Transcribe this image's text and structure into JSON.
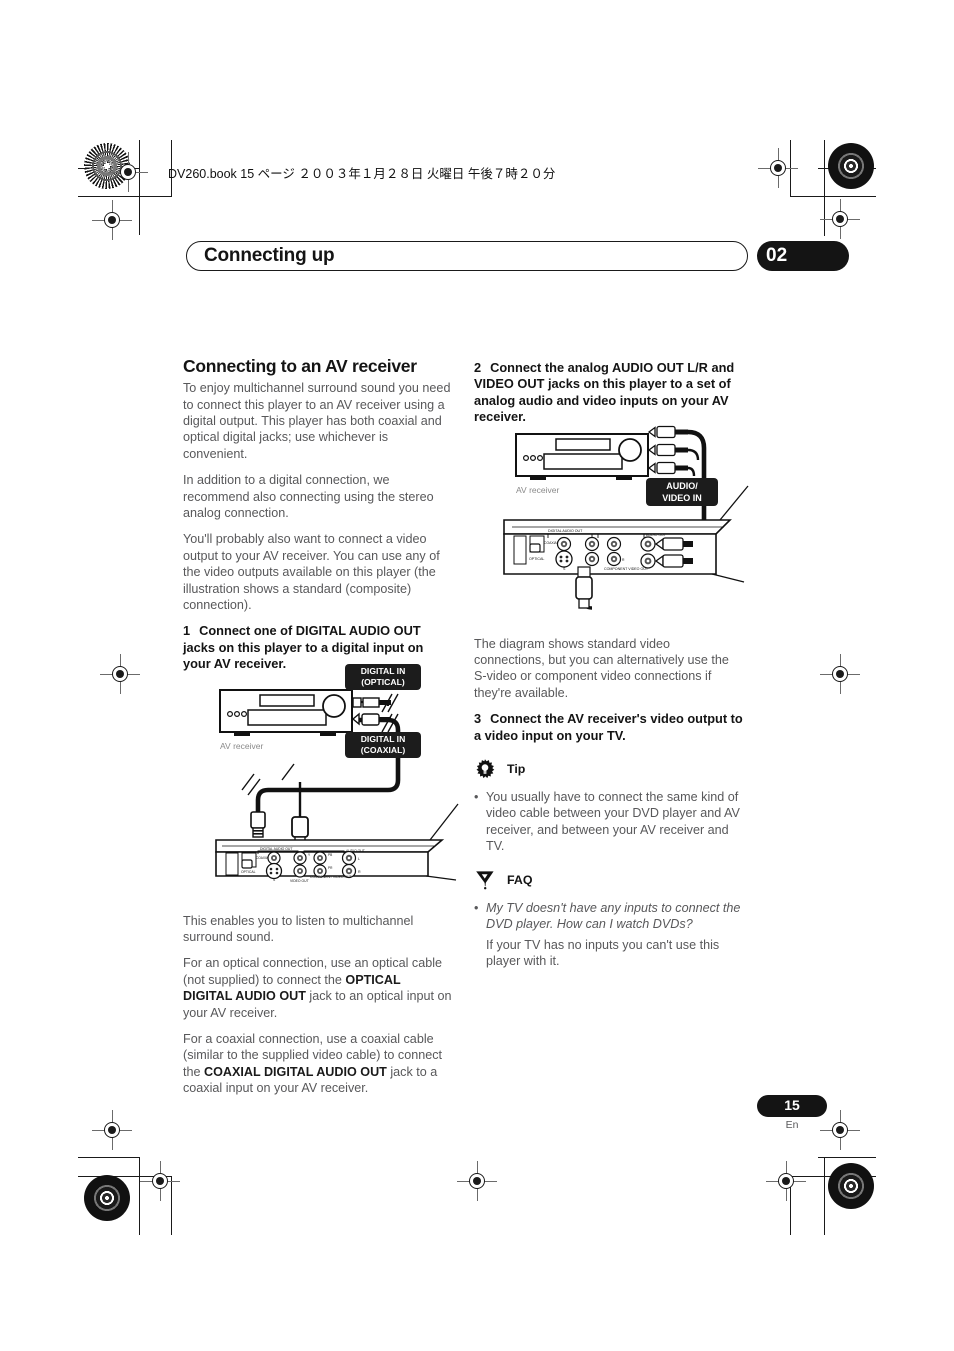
{
  "print": {
    "filestamp": "DV260.book  15 ページ  ２００３年１月２８日   火曜日   午後７時２０分"
  },
  "header": {
    "chapter_title": "Connecting up",
    "chapter_number": "02"
  },
  "left_column": {
    "heading": "Connecting to an AV receiver",
    "p1": "To enjoy multichannel surround sound you need to connect this player to an AV receiver using a digital output. This player has both coaxial and optical digital jacks; use whichever is convenient.",
    "p2": "In addition to a digital connection, we recommend also connecting using the stereo analog connection.",
    "p3": "You'll probably also want to connect a video output to your AV receiver. You can use any of the video outputs available on this player (the illustration shows a standard (composite) connection).",
    "step1_num": "1",
    "step1_text": "Connect one of DIGITAL AUDIO OUT jacks on this player to a digital input on your AV receiver.",
    "p4": "This enables you to listen to multichannel surround sound.",
    "p5_a": "For an optical connection, use an optical cable (not supplied) to connect the ",
    "p5_b": "OPTICAL DIGITAL AUDIO OUT",
    "p5_c": " jack to an optical input on your AV receiver.",
    "p6_a": "For a coaxial connection, use a coaxial cable (similar to the supplied video cable) to connect the ",
    "p6_b": "COAXIAL DIGITAL AUDIO OUT",
    "p6_c": " jack to a coaxial input on your AV receiver."
  },
  "right_column": {
    "step2_num": "2",
    "step2_text": "Connect the analog AUDIO OUT L/R and VIDEO OUT jacks on this player to a set of analog audio and video inputs on your AV receiver.",
    "p1": "The diagram shows standard video connections, but you can alternatively use the S-video or component video connections if they're available.",
    "step3_num": "3",
    "step3_text": "Connect the AV receiver's video output to a video input on your TV.",
    "tip": {
      "icon": "tip-bulb-icon",
      "label": "Tip",
      "bullet": "•",
      "text": "You usually have to connect the same kind of video cable between your DVD player and AV receiver, and between your AV receiver and TV."
    },
    "faq": {
      "icon": "faq-flag-icon",
      "label": "FAQ",
      "bullet": "•",
      "question": "My TV doesn't have any inputs to connect the DVD player. How can I watch DVDs?",
      "answer": "If your TV has no inputs you can't use this player with it."
    }
  },
  "diagram1": {
    "name": "digital-audio-connection-diagram",
    "device_caption": "AV receiver",
    "label_optical_l1": "DIGITAL IN",
    "label_optical_l2": "(OPTICAL)",
    "label_coaxial_l1": "DIGITAL IN",
    "label_coaxial_l2": "(COAXIAL)",
    "panel_labels": {
      "digital_audio_out": "DIGITAL AUDIO OUT",
      "coaxial": "COAXIAL",
      "optical": "OPTICAL",
      "video_out": "VIDEO OUT",
      "audio_out": "AUDIO OUT",
      "component_video_out": "COMPONENT VIDEO OUT",
      "left": "L",
      "right": "R",
      "s_video": "S",
      "video": "V",
      "y": "Y",
      "pb": "PB",
      "pr": "PR"
    }
  },
  "diagram2": {
    "name": "analog-av-connection-diagram",
    "device_caption": "AV receiver",
    "label_av_l1": "AUDIO/",
    "label_av_l2": "VIDEO IN",
    "panel_labels": {
      "digital_audio_out": "DIGITAL AUDIO OUT",
      "coaxial": "COAXIAL",
      "optical": "OPTICAL",
      "video_out": "VIDEO OUT",
      "audio_out": "AUDIO OUT",
      "component_video_out": "COMPONENT VIDEO OUT",
      "left": "L",
      "right": "R",
      "s_video": "S",
      "video": "V"
    }
  },
  "footer": {
    "page_number": "15",
    "language": "En"
  },
  "colors": {
    "ink": "#141414",
    "body_text": "#58585a",
    "badge_bg": "#141414",
    "badge_fg": "#ffffff"
  }
}
